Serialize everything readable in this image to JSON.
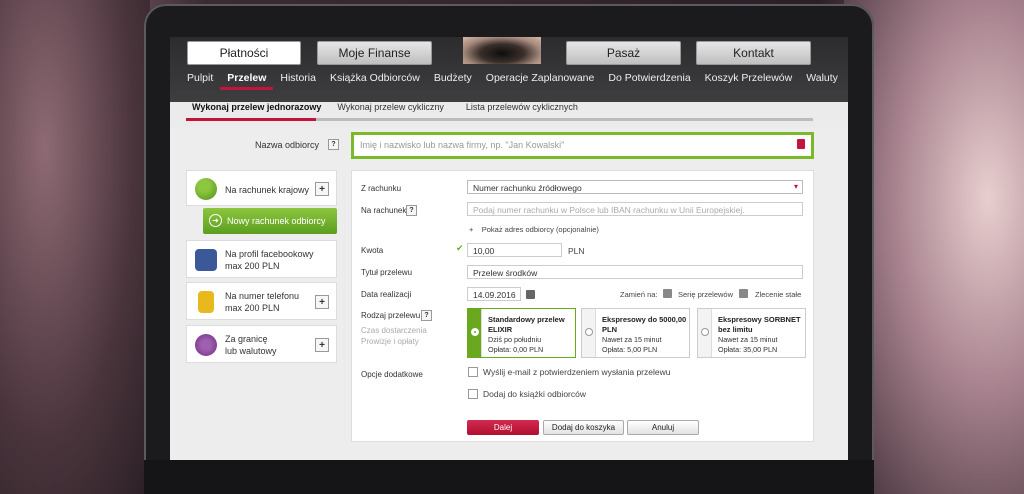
{
  "top_tabs": [
    "Płatności",
    "Moje Finanse",
    "Pasaż",
    "Kontakt"
  ],
  "menu": [
    "Pulpit",
    "Przelew",
    "Historia",
    "Książka Odbiorców",
    "Budżety",
    "Operacje Zaplanowane",
    "Do Potwierdzenia",
    "Koszyk Przelewów",
    "Waluty"
  ],
  "subtabs": [
    "Wykonaj przelew jednorazowy",
    "Wykonaj przelew cykliczny",
    "Lista przelewów cyklicznych"
  ],
  "recipient": {
    "label": "Nazwa odbiorcy",
    "help": "?",
    "placeholder": "Imię i nazwisko lub nazwa firmy, np. \"Jan Kowalski\""
  },
  "left_panel": {
    "domestic": "Na rachunek krajowy",
    "new_account_btn": "Nowy rachunek odbiorcy",
    "facebook_l1": "Na profil facebookowy",
    "facebook_l2": "max 200 PLN",
    "phone_l1": "Na numer telefonu",
    "phone_l2": "max 200 PLN",
    "abroad_l1": "Za granicę",
    "abroad_l2": "lub walutowy",
    "plus": "+"
  },
  "form": {
    "from_label": "Z rachunku",
    "from_value": "Numer rachunku źródłowego",
    "to_label": "Na rachunek",
    "to_placeholder": "Podaj numer rachunku w Polsce lub IBAN rachunku w Unii Europejskiej.",
    "show_address": "Pokaż adres odbiorcy (opcjonalnie)",
    "amount_label": "Kwota",
    "amount_value": "10,00",
    "currency": "PLN",
    "title_label": "Tytuł przelewu",
    "title_value": "Przelew środków",
    "date_label": "Data realizacji",
    "date_value": "14.09.2016",
    "convert_label": "Zamień na:",
    "series_label": "Serię przelewów",
    "standing_label": "Zlecenie stałe",
    "type_label": "Rodzaj przelewu",
    "delivery_label": "Czas dostarczenia",
    "fees_label": "Prowizje i opłaty",
    "options": [
      {
        "title": "Standardowy przelew ELIXIR",
        "l1": "Dziś po południu",
        "l2": "Opłata: 0,00 PLN"
      },
      {
        "title": "Ekspresowy do 5000,00 PLN",
        "l1": "Nawet za 15 minut",
        "l2": "Opłata: 5,00 PLN"
      },
      {
        "title": "Ekspresowy SORBNET bez limitu",
        "l1": "Nawet za 15 minut",
        "l2": "Opłata: 35,00 PLN"
      }
    ],
    "extra_label": "Opcje dodatkowe",
    "extra_email": "Wyślij e-mail z potwierdzeniem wysłania przelewu",
    "extra_book": "Dodaj do książki odbiorców",
    "btn_next": "Dalej",
    "btn_cart": "Dodaj do koszyka",
    "btn_cancel": "Anuluj"
  },
  "colors": {
    "accent": "#c2143c",
    "green": "#7ab929"
  }
}
